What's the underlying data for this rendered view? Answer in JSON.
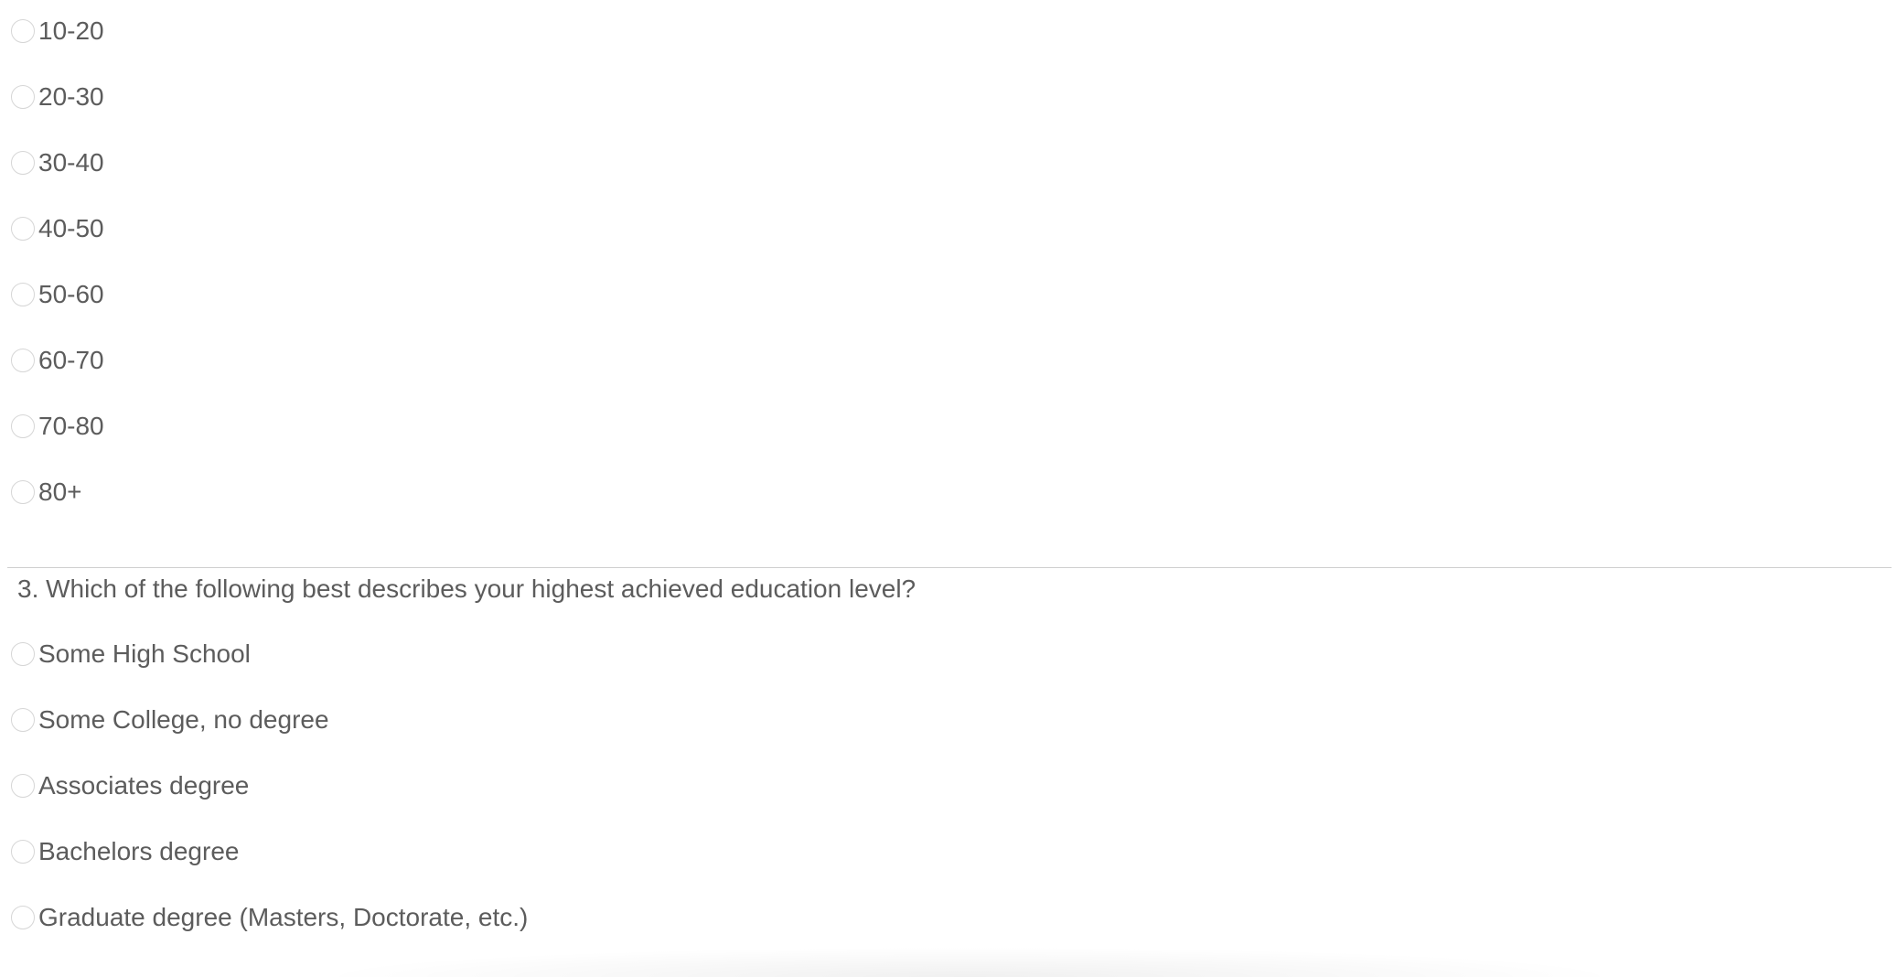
{
  "age_options": [
    {
      "label": "10-20"
    },
    {
      "label": "20-30"
    },
    {
      "label": "30-40"
    },
    {
      "label": "40-50"
    },
    {
      "label": "50-60"
    },
    {
      "label": "60-70"
    },
    {
      "label": "70-80"
    },
    {
      "label": "80+"
    }
  ],
  "question3": {
    "text": "3. Which of the following best describes your highest achieved education level?",
    "options": [
      {
        "label": "Some High School"
      },
      {
        "label": "Some College, no degree"
      },
      {
        "label": "Associates degree"
      },
      {
        "label": "Bachelors degree"
      },
      {
        "label": "Graduate degree (Masters, Doctorate, etc.)"
      }
    ]
  }
}
